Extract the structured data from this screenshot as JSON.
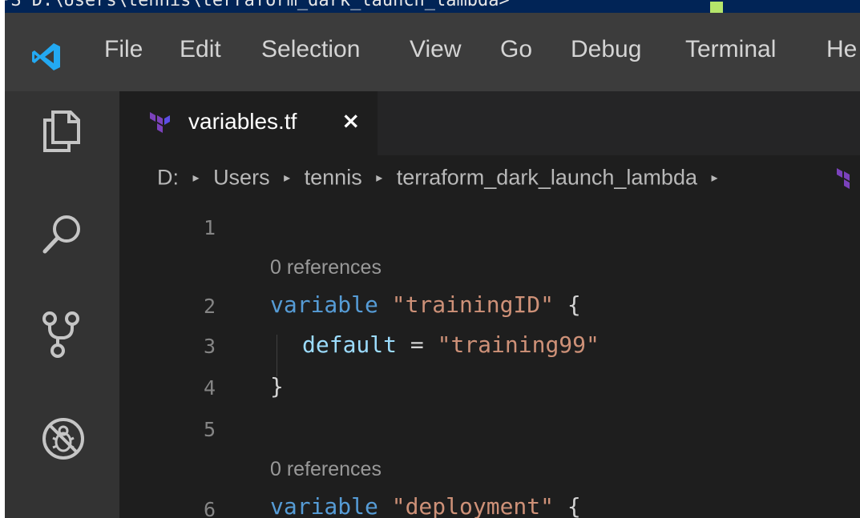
{
  "terminal": {
    "prompt": "PS D:\\Users\\tennis\\terraform_dark_launch_lambda> "
  },
  "menubar": {
    "items": [
      "File",
      "Edit",
      "Selection",
      "View",
      "Go",
      "Debug",
      "Terminal",
      "He"
    ]
  },
  "activitybar": {
    "icons": [
      "explorer-icon",
      "search-icon",
      "source-control-icon",
      "debug-disabled-icon"
    ]
  },
  "tabs": [
    {
      "label": "variables.tf",
      "close": "×",
      "icon": "terraform-icon",
      "active": true
    }
  ],
  "breadcrumb": {
    "parts": [
      "D:",
      "Users",
      "tennis",
      "terraform_dark_launch_lambda"
    ],
    "separator": "▸"
  },
  "editor": {
    "line_numbers": [
      "1",
      "2",
      "3",
      "4",
      "5",
      "6"
    ],
    "codelens": [
      "0 references",
      "0 references"
    ],
    "lines": {
      "l2": {
        "keyword": "variable",
        "name": "\"trainingID\"",
        "brace": "{"
      },
      "l3": {
        "attr": "default",
        "eq": "=",
        "value": "\"training99\""
      },
      "l4": {
        "brace": "}"
      },
      "l6": {
        "keyword": "variable",
        "name": "\"deployment\"",
        "brace": "{"
      }
    }
  },
  "colors": {
    "keyword": "#569cd6",
    "string": "#ce9178",
    "attribute": "#9cdcfe",
    "terraform_purple": "#7b42bc",
    "vscode_blue": "#23a9f2"
  }
}
